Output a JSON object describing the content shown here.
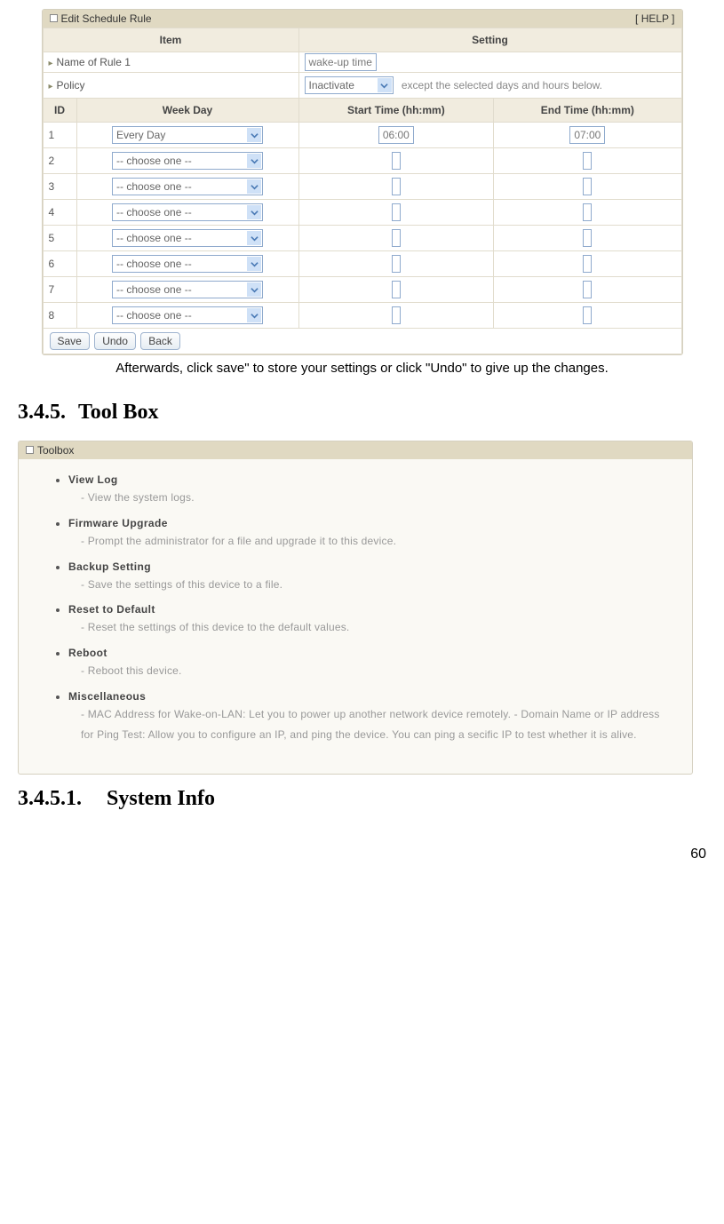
{
  "panel1": {
    "title": "Edit Schedule Rule",
    "help": "[ HELP ]",
    "th_item": "Item",
    "th_setting": "Setting",
    "row_name_label": "Name of Rule 1",
    "row_name_value": "wake-up time",
    "row_policy_label": "Policy",
    "row_policy_value": "Inactivate",
    "row_policy_note": "except the selected days and hours below.",
    "th_id": "ID",
    "th_weekday": "Week Day",
    "th_start": "Start Time (hh:mm)",
    "th_end": "End Time (hh:mm)",
    "rows": [
      {
        "id": "1",
        "weekday": "Every Day",
        "start": "06:00",
        "end": "07:00"
      },
      {
        "id": "2",
        "weekday": "-- choose one --",
        "start": "",
        "end": ""
      },
      {
        "id": "3",
        "weekday": "-- choose one --",
        "start": "",
        "end": ""
      },
      {
        "id": "4",
        "weekday": "-- choose one --",
        "start": "",
        "end": ""
      },
      {
        "id": "5",
        "weekday": "-- choose one --",
        "start": "",
        "end": ""
      },
      {
        "id": "6",
        "weekday": "-- choose one --",
        "start": "",
        "end": ""
      },
      {
        "id": "7",
        "weekday": "-- choose one --",
        "start": "",
        "end": ""
      },
      {
        "id": "8",
        "weekday": "-- choose one --",
        "start": "",
        "end": ""
      }
    ],
    "btn_save": "Save",
    "btn_undo": "Undo",
    "btn_back": "Back"
  },
  "after_text": "Afterwards, click save\" to store your settings or click \"Undo\" to give up the changes.",
  "sec_345_num": "3.4.5.",
  "sec_345_title": "Tool Box",
  "panel2": {
    "title": "Toolbox",
    "items": [
      {
        "hd": "View Log",
        "desc": "- View the system logs."
      },
      {
        "hd": "Firmware Upgrade",
        "desc": "- Prompt the administrator for a file and upgrade it to this device."
      },
      {
        "hd": "Backup Setting",
        "desc": "- Save the settings of this device to a file."
      },
      {
        "hd": "Reset to Default",
        "desc": "- Reset the settings of this device to the default values."
      },
      {
        "hd": "Reboot",
        "desc": "- Reboot this device."
      },
      {
        "hd": "Miscellaneous",
        "desc": "- MAC Address for Wake-on-LAN: Let you to power up another network device remotely.\n- Domain Name or IP address for Ping Test: Allow you to configure an IP, and ping the device. You can ping a secific IP to test whether it is alive."
      }
    ]
  },
  "sec_3451_num": "3.4.5.1.",
  "sec_3451_title": "System Info",
  "page_num": "60"
}
